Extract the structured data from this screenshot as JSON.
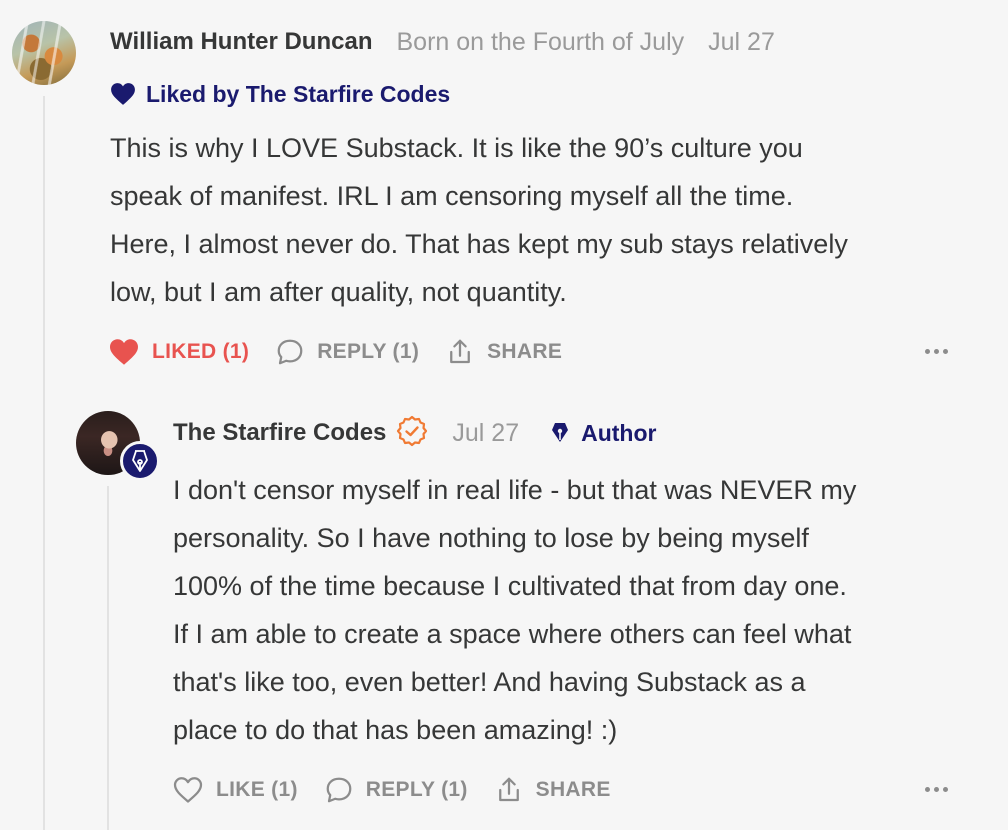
{
  "comment": {
    "author": "William Hunter Duncan",
    "publication": "Born on the Fourth of July",
    "date": "Jul 27",
    "liked_by": "Liked by The Starfire Codes",
    "body_lines": [
      "This is why I LOVE Substack. It is like the 90’s culture you",
      "speak of manifest. IRL I am censoring myself all the time.",
      "Here, I almost never do. That has kept my sub stays relatively",
      "low, but I am after quality, not quantity."
    ],
    "actions": {
      "like_label": "LIKED (1)",
      "reply_label": "REPLY (1)",
      "share_label": "SHARE"
    },
    "like_color": "#e8534f"
  },
  "reply": {
    "author": "The Starfire Codes",
    "date": "Jul 27",
    "author_tag": "Author",
    "body_lines": [
      "I don't censor myself in real life - but that was NEVER my",
      "personality. So I have nothing to lose by being myself",
      "100% of the time because I cultivated that from day one.",
      "If I am able to create a space where others can feel what",
      "that's like too, even better! And having Substack as a",
      "place to do that has been amazing! :)"
    ],
    "actions": {
      "like_label": "LIKE (1)",
      "reply_label": "REPLY (1)",
      "share_label": "SHARE"
    },
    "verified_color": "#f07a33",
    "accent_color": "#1a1a6e"
  },
  "icons": [
    "heart-icon",
    "comment-bubble-icon",
    "share-icon",
    "more-dots-icon",
    "verified-check-icon",
    "pen-nib-icon"
  ]
}
